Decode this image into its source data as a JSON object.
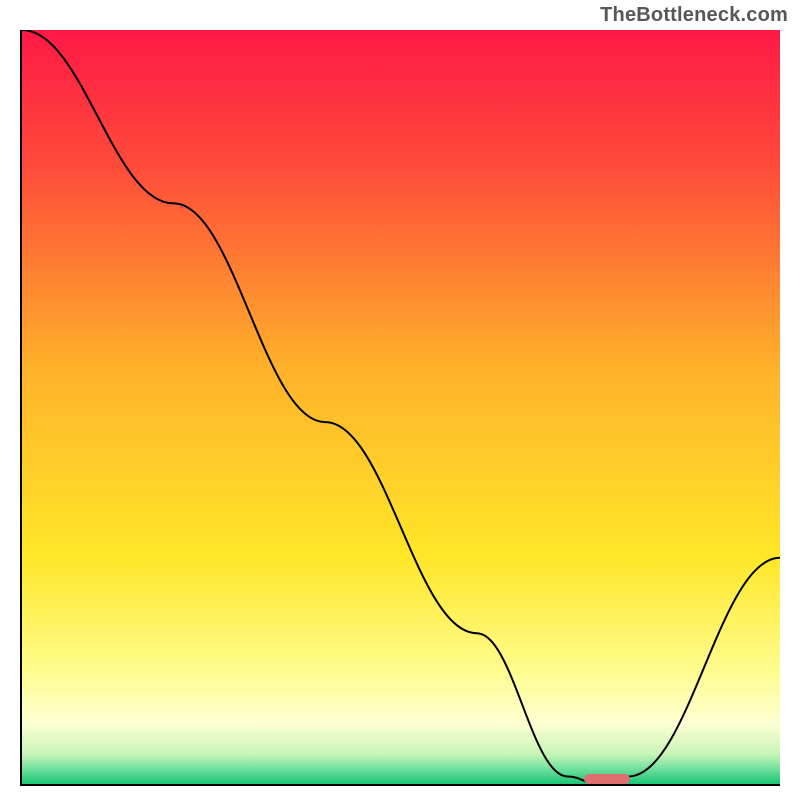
{
  "watermark": "TheBottleneck.com",
  "chart_data": {
    "type": "line",
    "title": "",
    "xlabel": "",
    "ylabel": "",
    "xlim": [
      0,
      100
    ],
    "ylim": [
      0,
      100
    ],
    "grid": false,
    "legend": false,
    "series": [
      {
        "name": "bottleneck-curve",
        "x": [
          0,
          20,
          40,
          60,
          72,
          76,
          80,
          100
        ],
        "y": [
          100,
          77,
          48,
          20,
          1,
          0,
          1,
          30
        ]
      }
    ],
    "marker": {
      "x_start": 74,
      "x_end": 80,
      "y": 0.7,
      "color": "#de6e70"
    },
    "background_gradient": {
      "stops": [
        {
          "pct": 0,
          "color": "#ff1846"
        },
        {
          "pct": 18,
          "color": "#ff4b3a"
        },
        {
          "pct": 45,
          "color": "#ffb22a"
        },
        {
          "pct": 70,
          "color": "#ffe728"
        },
        {
          "pct": 85,
          "color": "#fffc8e"
        },
        {
          "pct": 92,
          "color": "#fdffd2"
        },
        {
          "pct": 96,
          "color": "#c8f5b7"
        },
        {
          "pct": 98,
          "color": "#72e09e"
        },
        {
          "pct": 100,
          "color": "#18c572"
        }
      ]
    }
  }
}
